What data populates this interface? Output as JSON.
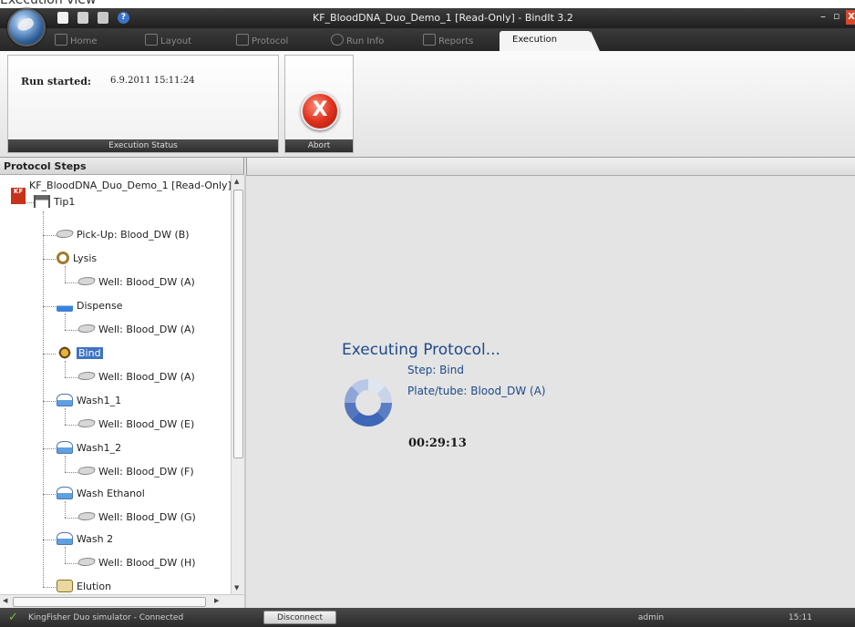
{
  "caption": "Execution view",
  "window": {
    "title": "KF_BloodDNA_Duo_Demo_1 [Read-Only] - BindIt 3.2",
    "minimize_glyph": "–",
    "maximize_glyph": "▫",
    "close_glyph": "X",
    "help_glyph": "?"
  },
  "tabs": [
    {
      "label": "Home",
      "icon": "home-icon"
    },
    {
      "label": "Layout",
      "icon": "layout-icon"
    },
    {
      "label": "Protocol",
      "icon": "protocol-icon"
    },
    {
      "label": "Run Info",
      "icon": "info-icon"
    },
    {
      "label": "Reports",
      "icon": "reports-icon"
    },
    {
      "label": "Execution",
      "icon": ""
    }
  ],
  "ribbon": {
    "run_started_label": "Run started:",
    "run_started_value": "6.9.2011 15:11:24",
    "status_group_label": "Execution Status",
    "abort_glyph": "X",
    "abort_group_label": "Abort"
  },
  "panel": {
    "title": "Protocol Steps"
  },
  "tree": {
    "kf_badge": "KF\nDuo",
    "root": "KF_BloodDNA_Duo_Demo_1 [Read-Only]",
    "tip": "Tip1",
    "nodes": [
      {
        "label": "Pick-Up: Blood_DW (B)",
        "icon": "plate-icon"
      },
      {
        "label": "Lysis",
        "icon": "lysis-icon"
      },
      {
        "label": "Well: Blood_DW (A)",
        "icon": "plate-icon"
      },
      {
        "label": "Dispense",
        "icon": "dispense-icon"
      },
      {
        "label": "Well: Blood_DW (A)",
        "icon": "plate-icon"
      },
      {
        "label": "Bind",
        "icon": "bind-icon"
      },
      {
        "label": "Well: Blood_DW (A)",
        "icon": "plate-icon"
      },
      {
        "label": "Wash1_1",
        "icon": "wash-icon"
      },
      {
        "label": "Well: Blood_DW (E)",
        "icon": "plate-icon"
      },
      {
        "label": "Wash1_2",
        "icon": "wash-icon"
      },
      {
        "label": "Well: Blood_DW (F)",
        "icon": "plate-icon"
      },
      {
        "label": "Wash Ethanol",
        "icon": "wash-icon"
      },
      {
        "label": "Well: Blood_DW (G)",
        "icon": "plate-icon"
      },
      {
        "label": "Wash 2",
        "icon": "wash-icon"
      },
      {
        "label": "Well: Blood_DW (H)",
        "icon": "plate-icon"
      },
      {
        "label": "Elution",
        "icon": "elution-icon"
      }
    ],
    "selected": "Bind"
  },
  "execution": {
    "title": "Executing Protocol...",
    "step": "Step: Bind",
    "plate": "Plate/tube: Blood_DW (A)",
    "elapsed": "00:29:13"
  },
  "statusbar": {
    "connection": "KingFisher Duo simulator - Connected",
    "disconnect_label": "Disconnect",
    "user": "admin",
    "time": "15:11"
  },
  "colors": {
    "accent": "#3d73c4",
    "exec_text": "#1d4a8a",
    "abort": "#e0321e",
    "connected": "#6ec13a"
  }
}
